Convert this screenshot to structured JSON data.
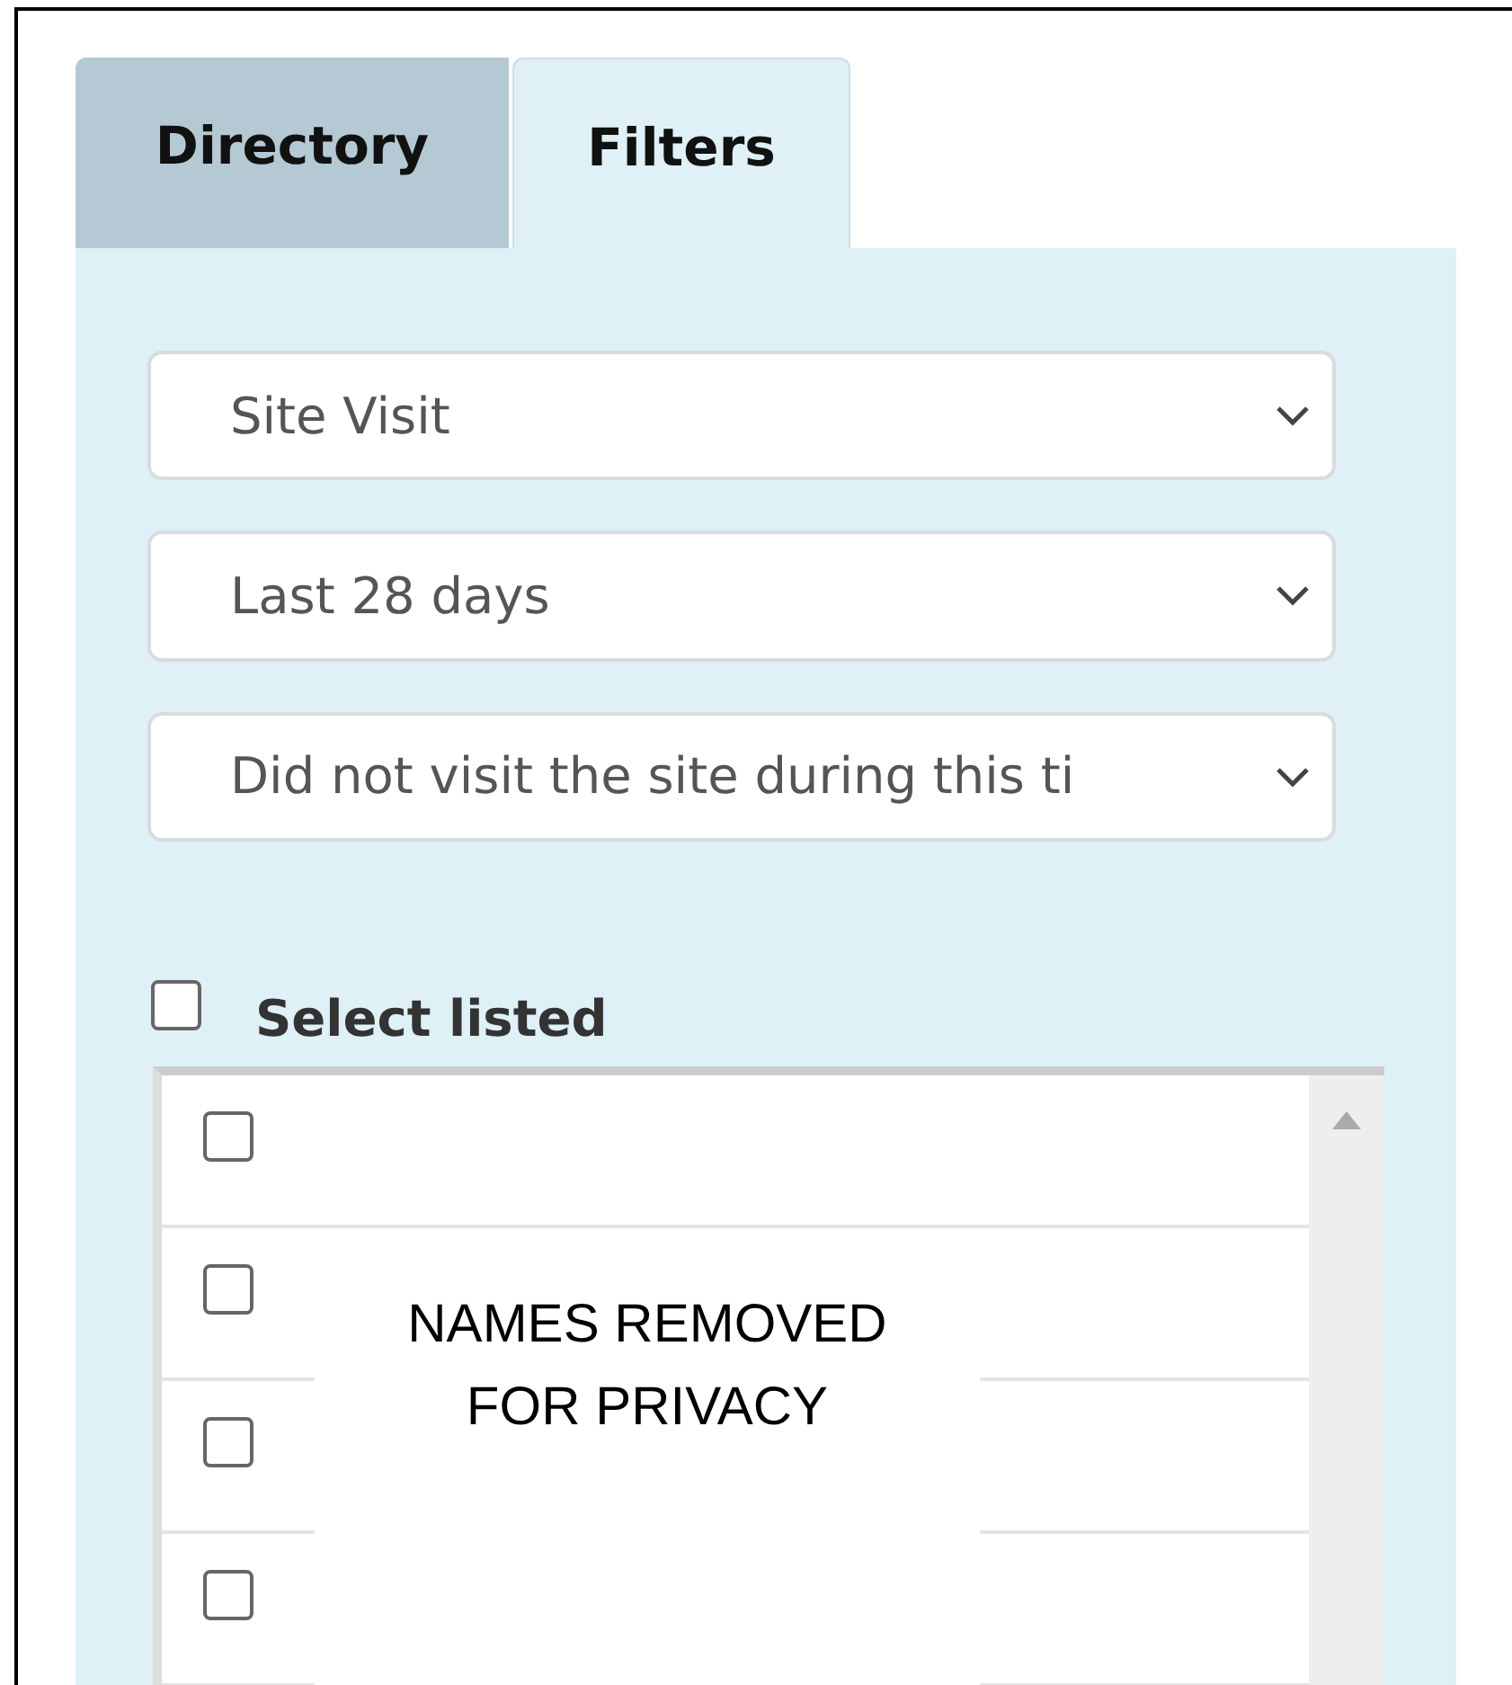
{
  "tabs": [
    {
      "label": "Directory",
      "selected": false
    },
    {
      "label": "Filters",
      "selected": true
    }
  ],
  "filters": [
    {
      "value": "Site Visit"
    },
    {
      "value": "Last 28 days"
    },
    {
      "value": "Did not visit the site during this ti"
    }
  ],
  "select_listed": {
    "label": "Select listed",
    "checked": false
  },
  "list": {
    "rows": [
      {
        "checked": false
      },
      {
        "checked": false
      },
      {
        "checked": false
      },
      {
        "checked": false
      }
    ]
  },
  "redaction_note": "NAMES REMOVED\nFOR PRIVACY"
}
